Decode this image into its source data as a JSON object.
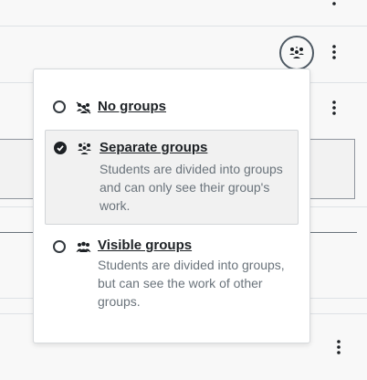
{
  "group_menu": {
    "options": [
      {
        "label": "No groups",
        "description": "",
        "selected": false,
        "icon": "no-groups-icon"
      },
      {
        "label": "Separate groups",
        "description": "Students are divided into groups and can only see their group's work.",
        "selected": true,
        "icon": "separate-groups-icon"
      },
      {
        "label": "Visible groups",
        "description": "Students are divided into groups, but can see the work of other groups.",
        "selected": false,
        "icon": "visible-groups-icon"
      }
    ]
  },
  "colors": {
    "page_background": "#f8f8f8",
    "text": "#1d2125",
    "muted_text": "#6a737b",
    "selected_background": "#f1f1f1"
  }
}
